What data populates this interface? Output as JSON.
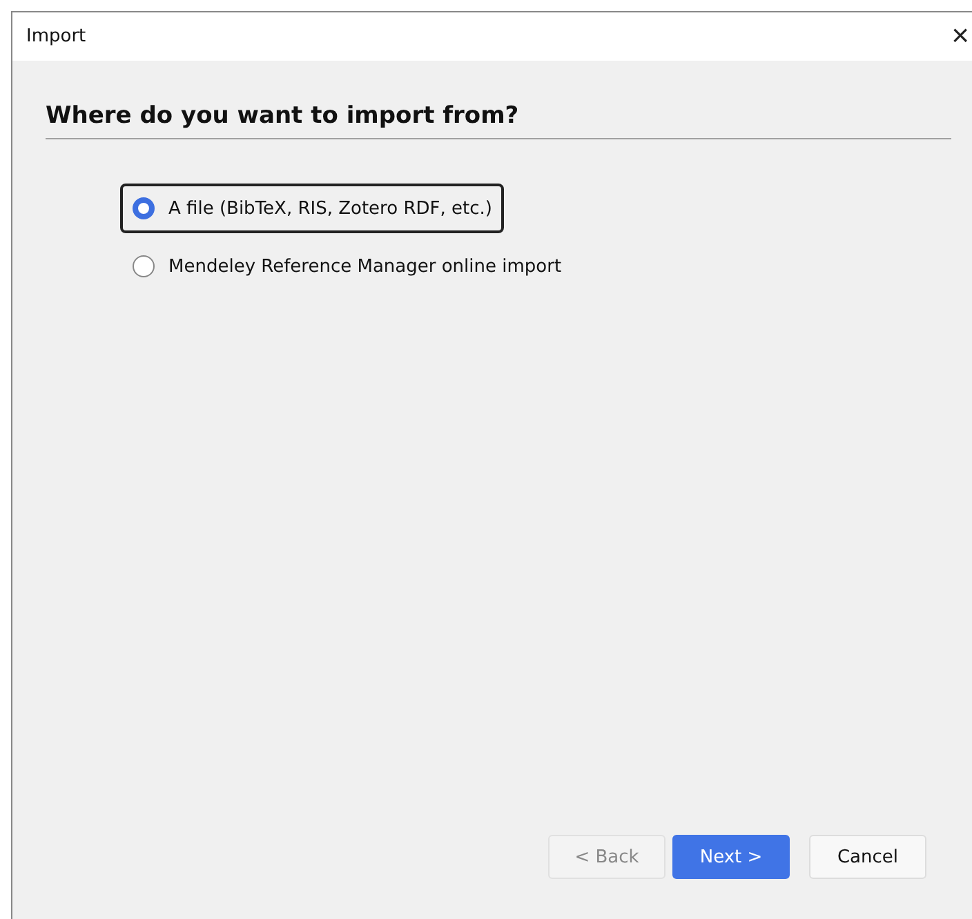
{
  "window": {
    "title": "Import",
    "close": "×"
  },
  "heading": "Where do you want to import from?",
  "options": [
    {
      "label": "A file (BibTeX, RIS, Zotero RDF, etc.)",
      "selected": true
    },
    {
      "label": "Mendeley Reference Manager online import",
      "selected": false
    }
  ],
  "buttons": [
    {
      "label": "< Back",
      "kind": "secondary",
      "disabled": true
    },
    {
      "label": "Next >",
      "kind": "primary",
      "disabled": false
    },
    {
      "label": "Cancel",
      "kind": "secondary",
      "disabled": false
    }
  ]
}
